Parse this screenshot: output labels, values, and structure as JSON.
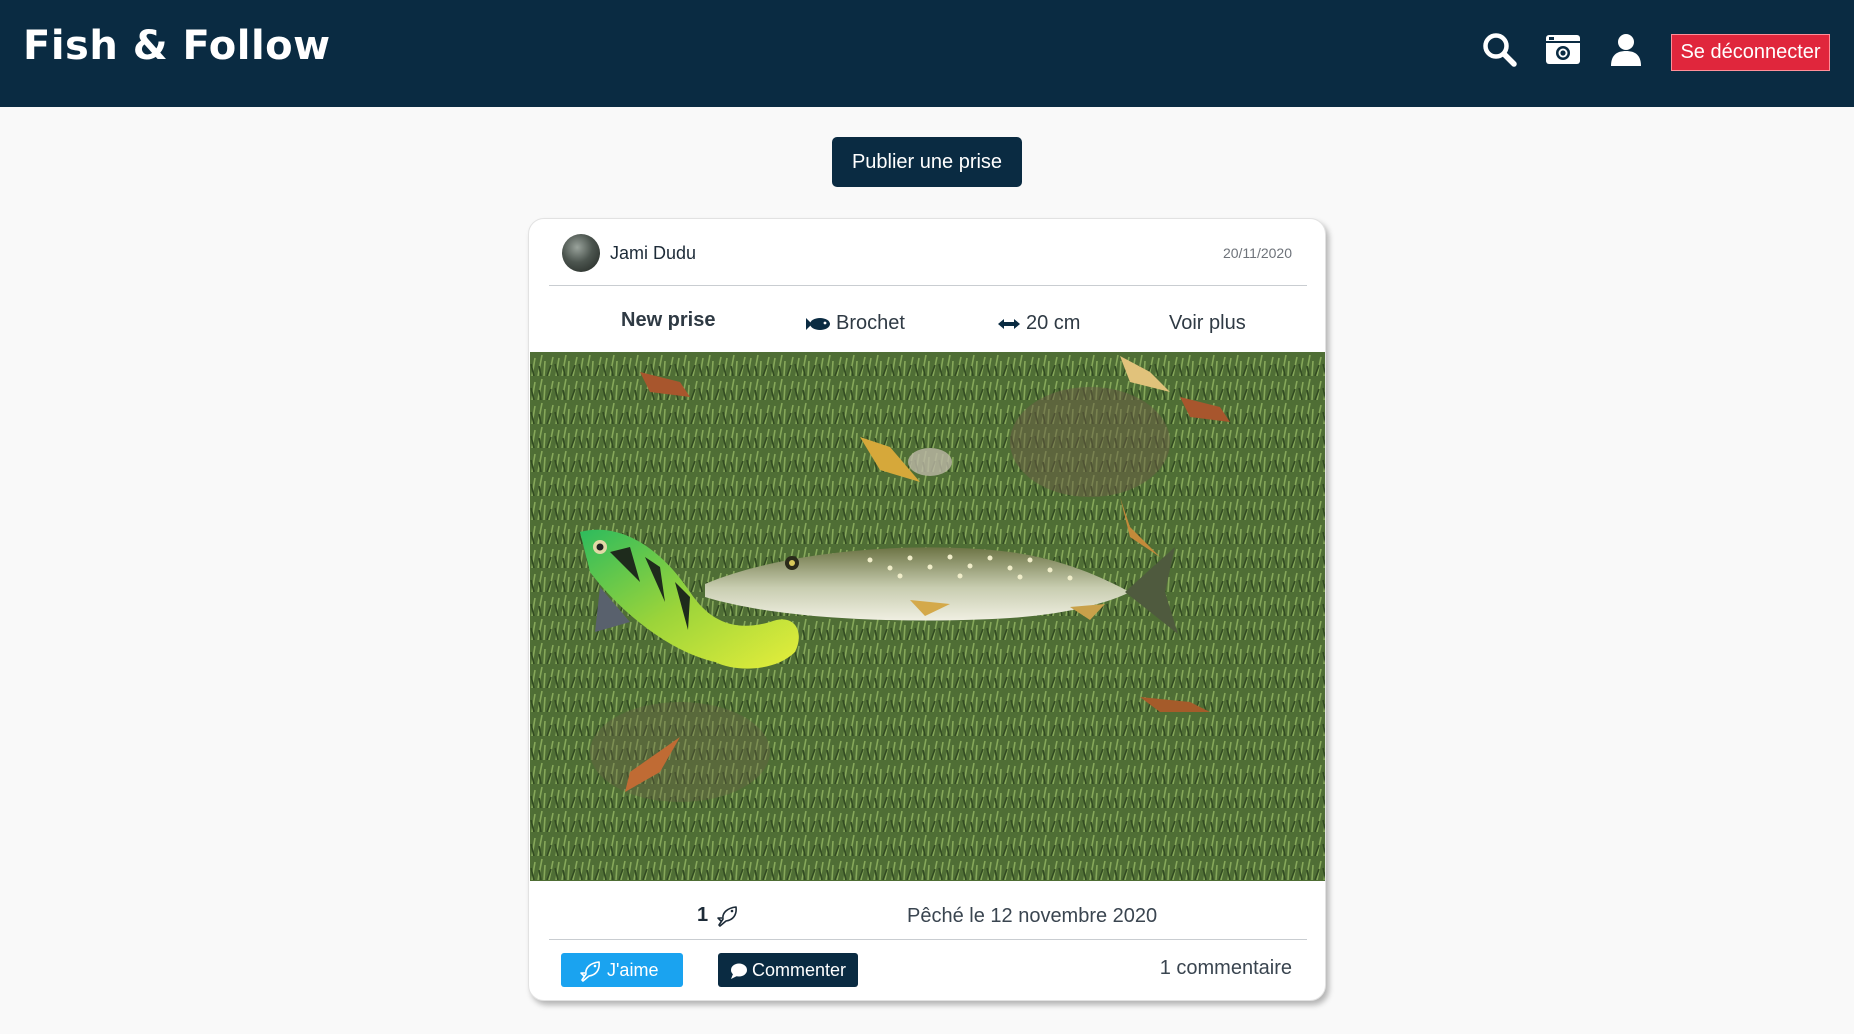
{
  "header": {
    "brand": "Fish & Follow",
    "icons": [
      "search-icon",
      "camera-icon",
      "user-icon"
    ],
    "logout_label": "Se déconnecter"
  },
  "main": {
    "publish_label": "Publier une prise"
  },
  "post": {
    "author": "Jami Dudu",
    "date": "20/11/2020",
    "title": "New prise",
    "species": "Brochet",
    "size": "20 cm",
    "more_label": "Voir plus",
    "likes": "1",
    "caught_text": "Pêché le 12 novembre 2020",
    "like_label": "J'aime",
    "comment_label": "Commenter",
    "comments_count": "1 commentaire"
  },
  "colors": {
    "navbar": "#0a2b42",
    "logout": "#e0263c",
    "like": "#1aa3f0"
  }
}
